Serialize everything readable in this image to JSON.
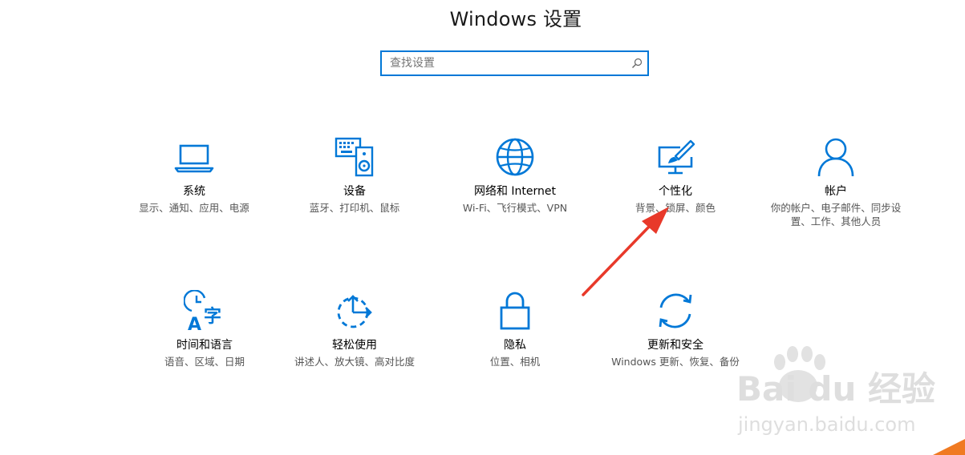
{
  "window": {
    "title": "Windows 设置"
  },
  "search": {
    "placeholder": "查找设置"
  },
  "tiles": [
    {
      "name": "系统",
      "desc": "显示、通知、应用、电源",
      "icon": "laptop-icon"
    },
    {
      "name": "设备",
      "desc": "蓝牙、打印机、鼠标",
      "icon": "keyboard-speaker-icon"
    },
    {
      "name": "网络和 Internet",
      "desc": "Wi-Fi、飞行模式、VPN",
      "icon": "globe-icon"
    },
    {
      "name": "个性化",
      "desc": "背景、锁屏、颜色",
      "icon": "paint-brush-icon"
    },
    {
      "name": "帐户",
      "desc": "你的帐户、电子邮件、同步设置、工作、其他人员",
      "icon": "person-icon"
    },
    {
      "name": "时间和语言",
      "desc": "语音、区域、日期",
      "icon": "time-language-icon"
    },
    {
      "name": "轻松使用",
      "desc": "讲述人、放大镜、高对比度",
      "icon": "ease-of-access-icon"
    },
    {
      "name": "隐私",
      "desc": "位置、相机",
      "icon": "lock-icon"
    },
    {
      "name": "更新和安全",
      "desc": "Windows 更新、恢复、备份",
      "icon": "sync-icon"
    }
  ],
  "watermark": {
    "brand": "Bai du 经验",
    "url": "jingyan.baidu.com"
  },
  "colors": {
    "accent": "#0078d7",
    "annotation_arrow": "#e8392a"
  }
}
